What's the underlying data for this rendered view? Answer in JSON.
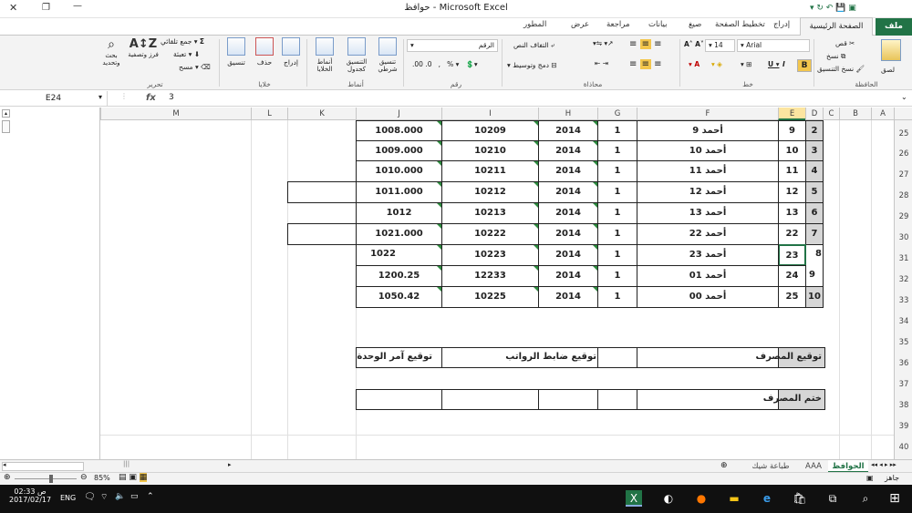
{
  "window": {
    "title": "حوافظ - Microsoft Excel"
  },
  "tabs": {
    "file": "ملف",
    "home": "الصفحة الرئيسية",
    "insert": "إدراج",
    "page_layout": "تخطيط الصفحة",
    "formulas": "صيغ",
    "data": "بيانات",
    "review": "مراجعة",
    "view": "عرض",
    "developer": "المطور"
  },
  "ribbon": {
    "clipboard": {
      "paste": "لصق",
      "cut": "قص",
      "copy": "نسخ",
      "format_painter": "نسخ التنسيق",
      "group": "الحافظة"
    },
    "font": {
      "name": "Arial",
      "size": "14",
      "group": "خط"
    },
    "alignment": {
      "wrap": "التفاف النص",
      "merge": "دمج وتوسيط",
      "group": "محاذاة"
    },
    "number": {
      "format": "الرقم",
      "group": "رقم"
    },
    "styles": {
      "conditional": "تنسيق شرطي",
      "table": "التنسيق كجدول",
      "cell_styles": "أنماط الخلايا",
      "group": "أنماط"
    },
    "cells": {
      "insert": "إدراج",
      "delete": "حذف",
      "format": "تنسيق",
      "group": "خلايا"
    },
    "editing": {
      "autosum": "جمع تلقائي",
      "fill": "تعبئة",
      "clear": "مسح",
      "sort": "فرز وتصفية",
      "find": "بحث وتحديد",
      "group": "تحرير"
    }
  },
  "formula_bar": {
    "name_box": "E24",
    "fx": "fx",
    "value": "3"
  },
  "columns": [
    "A",
    "B",
    "C",
    "D",
    "E",
    "F",
    "G",
    "H",
    "I",
    "J",
    "K",
    "L",
    "M"
  ],
  "rows": [
    "25",
    "26",
    "27",
    "28",
    "29",
    "30",
    "31",
    "32",
    "33",
    "34",
    "35",
    "36",
    "37",
    "38",
    "39",
    "40"
  ],
  "data_rows": [
    {
      "d": "2",
      "e": "9",
      "f": "أحمد 9",
      "g": "1",
      "h": "2014",
      "i": "10209",
      "j": "1008.000"
    },
    {
      "d": "3",
      "e": "10",
      "f": "أحمد 10",
      "g": "1",
      "h": "2014",
      "i": "10210",
      "j": "1009.000"
    },
    {
      "d": "4",
      "e": "11",
      "f": "أحمد 11",
      "g": "1",
      "h": "2014",
      "i": "10211",
      "j": "1010.000"
    },
    {
      "d": "5",
      "e": "12",
      "f": "أحمد 12",
      "g": "1",
      "h": "2014",
      "i": "10212",
      "j": "1011.000"
    },
    {
      "d": "6",
      "e": "13",
      "f": "أحمد 13",
      "g": "1",
      "h": "2014",
      "i": "10213",
      "j": "1012"
    },
    {
      "d": "7",
      "e": "22",
      "f": "أحمد 22",
      "g": "1",
      "h": "2014",
      "i": "10222",
      "j": "1021.000"
    },
    {
      "d": "8",
      "e": "23",
      "f": "أحمد 23",
      "g": "1",
      "h": "2014",
      "i": "10223",
      "j": "1022"
    },
    {
      "d": "9",
      "e": "24",
      "f": "أحمد 01",
      "g": "1",
      "h": "2014",
      "i": "12233",
      "j": "1200.25"
    },
    {
      "d": "10",
      "e": "25",
      "f": "أحمد 00",
      "g": "1",
      "h": "2014",
      "i": "10225",
      "j": "1050.42"
    }
  ],
  "signatures": {
    "bank": "توقيع المصرف",
    "narrative_officer": "توقيع ضابط الرواتب",
    "unit_commander": "توقيع آمر الوحدة",
    "bank_stamp": "ختم المصرف"
  },
  "sheet_tabs": {
    "active": "الحوافظ",
    "tab2": "AAA",
    "tab3": "طباعة شيك"
  },
  "status": {
    "ready": "جاهز",
    "zoom": "85%"
  },
  "taskbar": {
    "time": "02:33 ص",
    "date": "2017/02/17",
    "lang": "ENG"
  }
}
